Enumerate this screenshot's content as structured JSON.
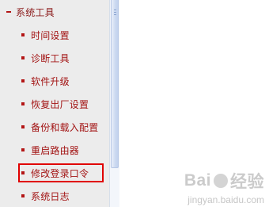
{
  "sidebar": {
    "section_title": "系统工具",
    "items": [
      {
        "label": "时间设置"
      },
      {
        "label": "诊断工具"
      },
      {
        "label": "软件升级"
      },
      {
        "label": "恢复出厂设置"
      },
      {
        "label": "备份和载入配置"
      },
      {
        "label": "重启路由器"
      },
      {
        "label": "修改登录口令"
      },
      {
        "label": "系统日志"
      }
    ],
    "highlighted_item": "修改登录口令"
  },
  "colors": {
    "sidebar_bg": "#ececec",
    "menu_text": "#a31515",
    "highlight_border": "#e00000"
  },
  "watermark": {
    "brand_left": "Bai",
    "brand_right": "经验",
    "sub": "jingyan.baidu.com"
  }
}
